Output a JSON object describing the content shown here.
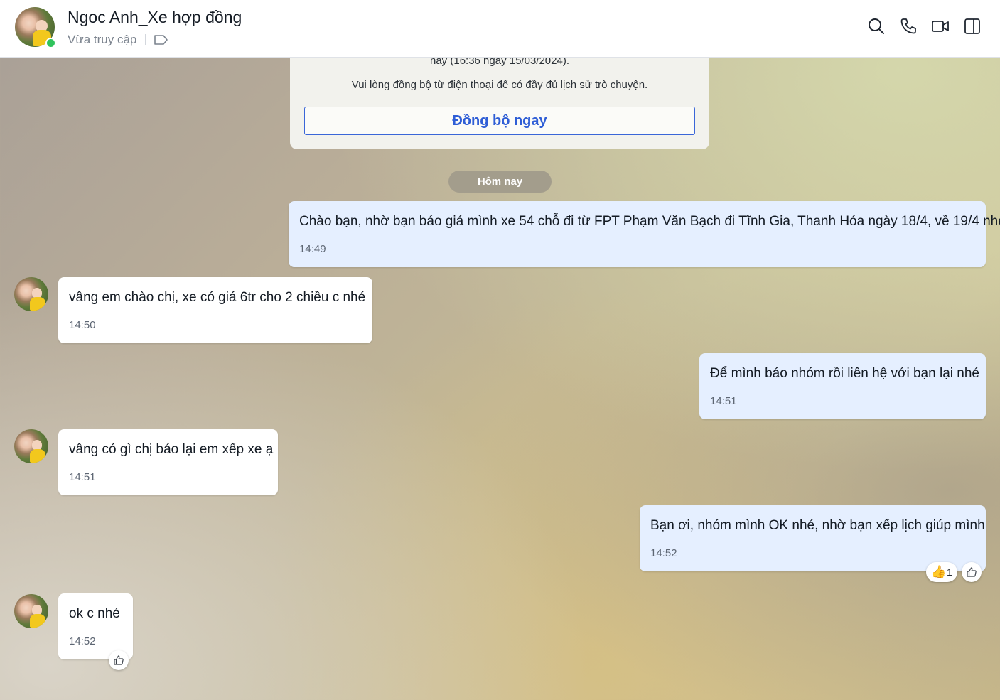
{
  "header": {
    "contact_name": "Ngoc Anh_Xe hợp đồng",
    "status": "Vừa truy cập",
    "icons": [
      "search-icon",
      "phone-icon",
      "video-call-icon",
      "sidebar-toggle-icon",
      "tag-icon"
    ]
  },
  "sync_notice": {
    "top_line": "nay (16:36 ngày 15/03/2024).",
    "message": "Vui lòng đồng bộ từ điện thoại để có đầy đủ lịch sử trò chuyện.",
    "button_label": "Đồng bộ ngay"
  },
  "date_divider": "Hôm nay",
  "messages": [
    {
      "direction": "out",
      "text": "Chào bạn, nhờ bạn báo giá mình xe 54 chỗ đi từ FPT Phạm Văn Bạch đi Tĩnh Gia, Thanh Hóa ngày 18/4, về 19/4 nhé",
      "time": "14:49"
    },
    {
      "direction": "in",
      "text": "vâng em chào chị, xe có giá 6tr cho 2 chiều c nhé",
      "time": "14:50"
    },
    {
      "direction": "out",
      "text": "Để mình báo nhóm rồi liên hệ với bạn lại nhé",
      "time": "14:51"
    },
    {
      "direction": "in",
      "text": "vâng có gì chị báo lại em xếp xe ạ",
      "time": "14:51"
    },
    {
      "direction": "out",
      "text": "Bạn ơi, nhóm mình OK nhé, nhờ bạn xếp lịch giúp mình",
      "time": "14:52",
      "reaction": {
        "emoji": "👍",
        "count": "1"
      }
    },
    {
      "direction": "in",
      "text": "ok c nhé",
      "time": "14:52"
    }
  ],
  "colors": {
    "outgoing_bubble": "#e5efff",
    "incoming_bubble": "#ffffff",
    "accent": "#2f5ed6",
    "online": "#30c35c"
  }
}
